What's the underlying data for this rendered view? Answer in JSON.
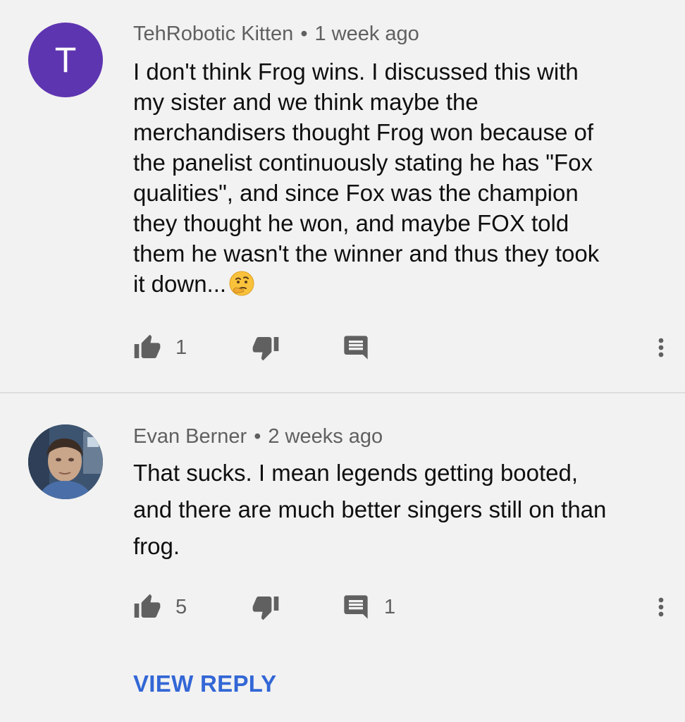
{
  "comments": [
    {
      "avatar_letter": "T",
      "author": "TehRobotic Kitten",
      "separator": "•",
      "time": "1 week ago",
      "text": "I don't think Frog wins. I discussed this with\nmy sister and we think maybe the\nmerchandisers thought Frog won because of\nthe panelist continuously stating he has \"Fox\nqualities\", and since Fox was the champion\nthey thought he won, and maybe FOX told\nthem he wasn't the winner and thus they took\nit down...",
      "emoji": "thinking-face-emoji",
      "likes": "1",
      "replies": ""
    },
    {
      "avatar": "profile-photo",
      "author": "Evan Berner",
      "separator": "•",
      "time": "2 weeks ago",
      "text": "That sucks. I mean legends getting booted,\nand there are much better singers still on than\nfrog.",
      "likes": "5",
      "replies": "1"
    }
  ],
  "view_reply_label": "VIEW REPLY",
  "colors": {
    "background": "#f2f2f2",
    "avatar_purple": "#5e35b1",
    "link_blue": "#3367d6",
    "meta_gray": "#606060",
    "text": "#0f0f0f"
  },
  "icons": [
    "thumbs-up-icon",
    "thumbs-down-icon",
    "reply-icon",
    "more-vert-icon"
  ]
}
